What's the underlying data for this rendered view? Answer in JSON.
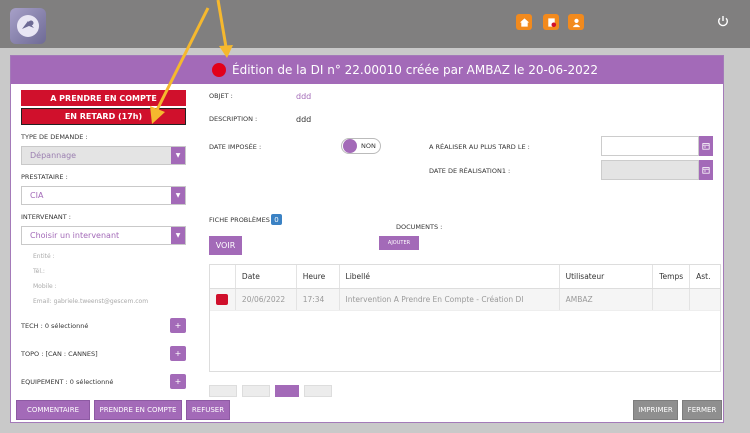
{
  "topbar": {
    "user_line1": "",
    "user_line2": ""
  },
  "modal": {
    "title": "Édition de la DI n° 22.00010 créée par AMBAZ le 20-06-2022"
  },
  "left": {
    "btn_prendre": "A PRENDRE EN COMPTE",
    "btn_retard": "EN RETARD (17h)",
    "type_label": "TYPE DE DEMANDE :",
    "type_value": "Dépannage",
    "prestataire_label": "PRESTATAIRE :",
    "prestataire_value": "CIA",
    "intervenant_label": "INTERVENANT :",
    "intervenant_placeholder": "Choisir un intervenant",
    "entite": "Entité :",
    "tel": "Tél.:",
    "mobile": "Mobile :",
    "email": "Email: gabriele.tweenst@gescem.com",
    "tech": "TECH : 0 sélectionné",
    "topo": "TOPO : [CAN : CANNES]",
    "equipement": "EQUIPEMENT : 0 sélectionné",
    "plus": "+"
  },
  "main": {
    "objet_label": "OBJET :",
    "objet_value": "ddd",
    "description_label": "DESCRIPTION :",
    "description_value": "ddd",
    "date_imposee_label": "DATE IMPOSÉE :",
    "toggle_text": "NON",
    "realiser_label": "A RÉALISER AU PLUS TARD LE :",
    "date_realisation_label": "DATE DE RÉALISATION1 :",
    "fiche_label": "FICHE PROBLÈMES :",
    "fiche_count": "0",
    "documents_label": "DOCUMENTS :",
    "voir": "VOIR",
    "ajouter": "AJOUTER"
  },
  "table": {
    "headers": [
      "",
      "Date",
      "Heure",
      "Libellé",
      "Utilisateur",
      "Temps",
      "Ast."
    ],
    "rows": [
      {
        "date": "20/06/2022",
        "heure": "17:34",
        "libelle": "Intervention A Prendre En Compte - Création DI",
        "utilisateur": "AMBAZ",
        "temps": "",
        "ast": ""
      }
    ]
  },
  "footer": {
    "commentaire": "COMMENTAIRE",
    "prendre": "PRENDRE EN COMPTE",
    "refuser": "REFUSER",
    "imprimer": "IMPRIMER",
    "fermer": "FERMER"
  },
  "colors": {
    "accent": "#a36ab8",
    "danger": "#d0102c",
    "annotation_arrow": "#f5b82e",
    "topbar": "#807f7f"
  }
}
